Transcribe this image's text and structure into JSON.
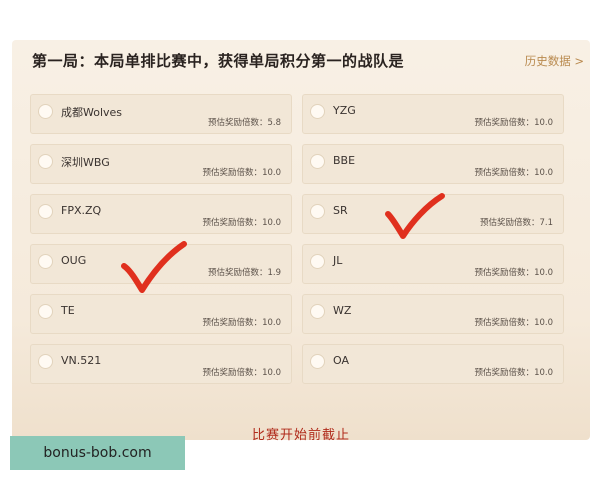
{
  "header": {
    "title": "第一局：本局单排比赛中，获得单局积分第一的战队是",
    "history_link": "历史数据 >"
  },
  "odds_prefix": "预估奖励倍数：",
  "options": [
    {
      "name": "成都Wolves",
      "odds": "5.8"
    },
    {
      "name": "YZG",
      "odds": "10.0"
    },
    {
      "name": "深圳WBG",
      "odds": "10.0"
    },
    {
      "name": "BBE",
      "odds": "10.0"
    },
    {
      "name": "FPX.ZQ",
      "odds": "10.0"
    },
    {
      "name": "SR",
      "odds": "7.1"
    },
    {
      "name": "OUG",
      "odds": "1.9"
    },
    {
      "name": "JL",
      "odds": "10.0"
    },
    {
      "name": "TE",
      "odds": "10.0"
    },
    {
      "name": "WZ",
      "odds": "10.0"
    },
    {
      "name": "VN.521",
      "odds": "10.0"
    },
    {
      "name": "OA",
      "odds": "10.0"
    }
  ],
  "footer": {
    "status": "比赛开始前截止"
  },
  "watermark": {
    "text": "bonus-bob.com"
  },
  "colors": {
    "accent": "#b98a4e",
    "check_mark": "#e0301e",
    "status": "#b02a1a"
  }
}
